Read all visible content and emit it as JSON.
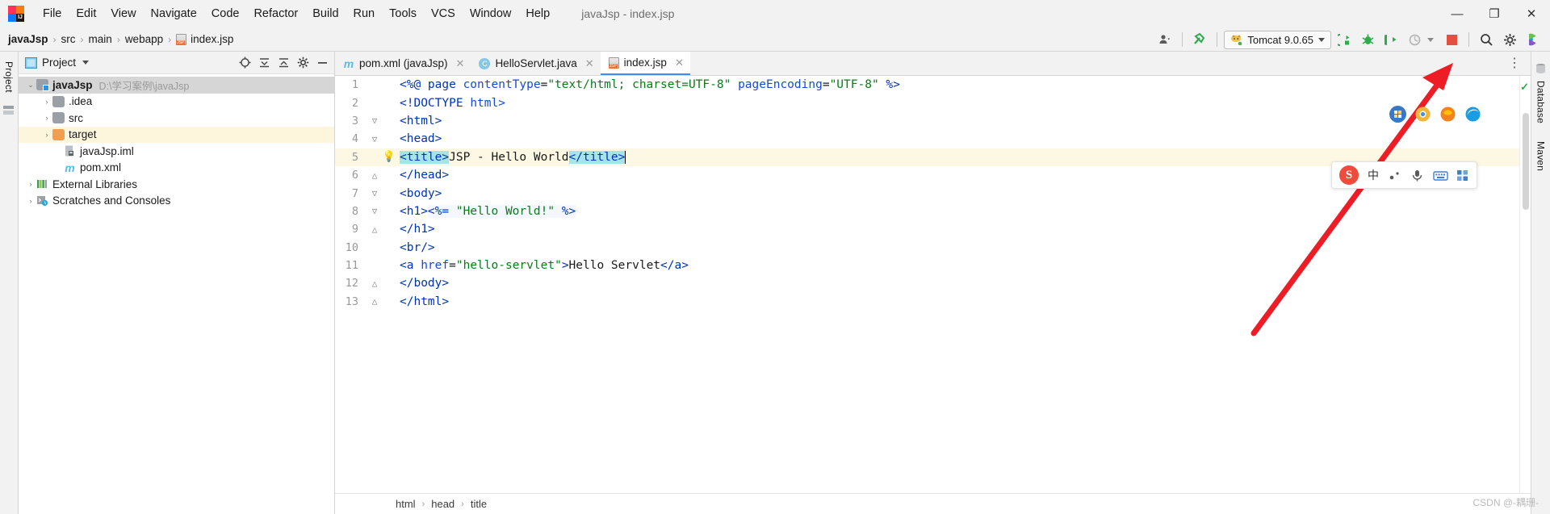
{
  "window": {
    "title": "javaJsp - index.jsp",
    "minimize_label": "—",
    "maximize_label": "❐",
    "close_label": "✕"
  },
  "menu": {
    "items": [
      {
        "label": "File"
      },
      {
        "label": "Edit"
      },
      {
        "label": "View"
      },
      {
        "label": "Navigate"
      },
      {
        "label": "Code"
      },
      {
        "label": "Refactor"
      },
      {
        "label": "Build"
      },
      {
        "label": "Run"
      },
      {
        "label": "Tools"
      },
      {
        "label": "VCS"
      },
      {
        "label": "Window"
      },
      {
        "label": "Help"
      }
    ]
  },
  "breadcrumbs": {
    "separator": "›",
    "items": [
      {
        "label": "javaJsp",
        "icon": "",
        "bold": true
      },
      {
        "label": "src",
        "icon": "",
        "bold": false
      },
      {
        "label": "main",
        "icon": "",
        "bold": false
      },
      {
        "label": "webapp",
        "icon": "",
        "bold": false
      },
      {
        "label": "index.jsp",
        "icon": "jsp-file-icon",
        "bold": false
      }
    ]
  },
  "toolbar": {
    "account_icon": "user-account-icon",
    "account_caret": "▾",
    "build_icon": "hammer-build-icon",
    "run_config": {
      "name": "Tomcat 9.0.65",
      "icon": "tomcat-icon",
      "caret": "▾"
    },
    "actions": [
      {
        "name": "run-button",
        "icon": "run-play-icon",
        "color": "#2eaa4f"
      },
      {
        "name": "debug-button",
        "icon": "debug-bug-icon",
        "color": "#2eaa4f"
      },
      {
        "name": "run-with-coverage-button",
        "icon": "coverage-icon",
        "color": "#2eaa4f"
      },
      {
        "name": "profile-button",
        "icon": "profiler-icon",
        "color": "#b8b8b8"
      },
      {
        "name": "stop-button",
        "icon": "stop-square-icon",
        "color": "#e25041"
      }
    ],
    "profile_caret": "▾",
    "search_icon": "search-magnifier-icon",
    "settings_icon": "gear-settings-icon",
    "ide_icon": "idea-updates-icon"
  },
  "left_strip": {
    "project_label": "Project",
    "structure_icon": "structure-icon"
  },
  "right_strip": {
    "database_label": "Database",
    "maven_label": "Maven"
  },
  "project_panel": {
    "title": "Project",
    "title_caret": "▾",
    "actions": [
      {
        "name": "select-opened-file-icon",
        "glyph": "⊕"
      },
      {
        "name": "expand-all-icon",
        "glyph": "⤓"
      },
      {
        "name": "collapse-all-icon",
        "glyph": "⤒"
      },
      {
        "name": "settings-gear-icon",
        "glyph": "⚙"
      },
      {
        "name": "hide-panel-icon",
        "glyph": "—"
      }
    ],
    "tree": [
      {
        "indent": 0,
        "arrow": "⌄",
        "icon": "module-folder-icon",
        "label": "javaJsp",
        "bold": true,
        "path": "D:\\学习案例\\javaJsp",
        "state": "selected"
      },
      {
        "indent": 1,
        "arrow": "›",
        "icon": "folder-icon",
        "label": ".idea",
        "bold": false,
        "path": "",
        "state": "none"
      },
      {
        "indent": 1,
        "arrow": "›",
        "icon": "folder-icon",
        "label": "src",
        "bold": false,
        "path": "",
        "state": "none"
      },
      {
        "indent": 1,
        "arrow": "›",
        "icon": "folder-orange-icon",
        "label": "target",
        "bold": false,
        "path": "",
        "state": "highlighted"
      },
      {
        "indent": 2,
        "arrow": "",
        "icon": "iml-file-icon",
        "label": "javaJsp.iml",
        "bold": false,
        "path": "",
        "state": "none"
      },
      {
        "indent": 2,
        "arrow": "",
        "icon": "maven-pom-icon",
        "label": "pom.xml",
        "bold": false,
        "path": "",
        "state": "none"
      },
      {
        "indent": 0,
        "arrow": "›",
        "icon": "external-libraries-icon",
        "label": "External Libraries",
        "bold": false,
        "path": "",
        "state": "none"
      },
      {
        "indent": 0,
        "arrow": "›",
        "icon": "scratches-icon",
        "label": "Scratches and Consoles",
        "bold": false,
        "path": "",
        "state": "none"
      }
    ]
  },
  "editor": {
    "tabs": [
      {
        "label": "pom.xml (javaJsp)",
        "icon": "maven-pom-icon",
        "active": false,
        "close": "✕"
      },
      {
        "label": "HelloServlet.java",
        "icon": "java-class-icon",
        "active": false,
        "close": "✕"
      },
      {
        "label": "index.jsp",
        "icon": "jsp-file-icon",
        "active": true,
        "close": "✕"
      }
    ],
    "tabs_more": "⋮",
    "inspection_ok": "✓",
    "lines": [
      {
        "num": "1",
        "fold": "",
        "bulb": false,
        "tokens": [
          {
            "t": "<%@ ",
            "c": "tag"
          },
          {
            "t": "page ",
            "c": "tag"
          },
          {
            "t": "contentType",
            "c": "attr"
          },
          {
            "t": "=",
            "c": "txt"
          },
          {
            "t": "\"text/html; charset=UTF-8\"",
            "c": "str"
          },
          {
            "t": " ",
            "c": "txt"
          },
          {
            "t": "pageEncoding",
            "c": "attr"
          },
          {
            "t": "=",
            "c": "txt"
          },
          {
            "t": "\"UTF-8\"",
            "c": "str"
          },
          {
            "t": " %>",
            "c": "tag"
          }
        ]
      },
      {
        "num": "2",
        "fold": "",
        "bulb": false,
        "tokens": [
          {
            "t": "<!DOCTYPE ",
            "c": "tag"
          },
          {
            "t": "html>",
            "c": "attr"
          }
        ]
      },
      {
        "num": "3",
        "fold": "start",
        "bulb": false,
        "tokens": [
          {
            "t": "<html>",
            "c": "tag"
          }
        ]
      },
      {
        "num": "4",
        "fold": "start",
        "bulb": false,
        "tokens": [
          {
            "t": "<head>",
            "c": "tag"
          }
        ]
      },
      {
        "num": "5",
        "fold": "",
        "bulb": true,
        "highlight": true,
        "tokens": [
          {
            "t": "<title>",
            "c": "tag",
            "sel": true
          },
          {
            "t": "JSP - Hello World",
            "c": "txt"
          },
          {
            "t": "</title>",
            "c": "tag",
            "sel": true
          },
          {
            "t": "CARET",
            "c": "caret"
          }
        ]
      },
      {
        "num": "6",
        "fold": "end",
        "bulb": false,
        "tokens": [
          {
            "t": "</head>",
            "c": "tag"
          }
        ]
      },
      {
        "num": "7",
        "fold": "start",
        "bulb": false,
        "tokens": [
          {
            "t": "<body>",
            "c": "tag"
          }
        ]
      },
      {
        "num": "8",
        "fold": "start",
        "bulb": false,
        "tokens": [
          {
            "t": "<h1>",
            "c": "tag"
          },
          {
            "t": "<%= ",
            "c": "tag",
            "jsp": true
          },
          {
            "t": "\"Hello World!\"",
            "c": "str",
            "jsp": true
          },
          {
            "t": " %>",
            "c": "tag",
            "jsp": true
          }
        ]
      },
      {
        "num": "9",
        "fold": "end",
        "bulb": false,
        "tokens": [
          {
            "t": "</h1>",
            "c": "tag"
          }
        ]
      },
      {
        "num": "10",
        "fold": "",
        "bulb": false,
        "tokens": [
          {
            "t": "<br/>",
            "c": "tag"
          }
        ]
      },
      {
        "num": "11",
        "fold": "",
        "bulb": false,
        "tokens": [
          {
            "t": "<a ",
            "c": "tag"
          },
          {
            "t": "href",
            "c": "attr"
          },
          {
            "t": "=",
            "c": "txt"
          },
          {
            "t": "\"hello-servlet\"",
            "c": "str"
          },
          {
            "t": ">",
            "c": "tag"
          },
          {
            "t": "Hello Servlet",
            "c": "txt"
          },
          {
            "t": "</a>",
            "c": "tag"
          }
        ]
      },
      {
        "num": "12",
        "fold": "end",
        "bulb": false,
        "tokens": [
          {
            "t": "</body>",
            "c": "tag"
          }
        ]
      },
      {
        "num": "13",
        "fold": "end",
        "bulb": false,
        "tokens": [
          {
            "t": "</html>",
            "c": "tag"
          }
        ]
      }
    ],
    "status_breadcrumbs": [
      "html",
      "head",
      "title"
    ],
    "status_separator": "›"
  },
  "overlays": {
    "browser_icons": [
      {
        "name": "ime-toolbox-icon",
        "color": "#3a78c4"
      },
      {
        "name": "chrome-browser-icon",
        "color": "#f3b63a"
      },
      {
        "name": "firefox-browser-icon",
        "color": "#f5811f"
      },
      {
        "name": "edge-browser-icon",
        "color": "#1b9de2"
      }
    ],
    "ime": {
      "logo": "S",
      "mode_label": "中",
      "punct_icon": "punctuation-icon",
      "mic_icon": "microphone-icon",
      "keyboard_icon": "keyboard-icon",
      "toolbox_icon": "toolbox-grid-icon"
    },
    "annotation_arrow": {
      "name": "red-annotation-arrow",
      "color": "#ee1d25"
    },
    "watermark": "CSDN @-耦珊-"
  }
}
